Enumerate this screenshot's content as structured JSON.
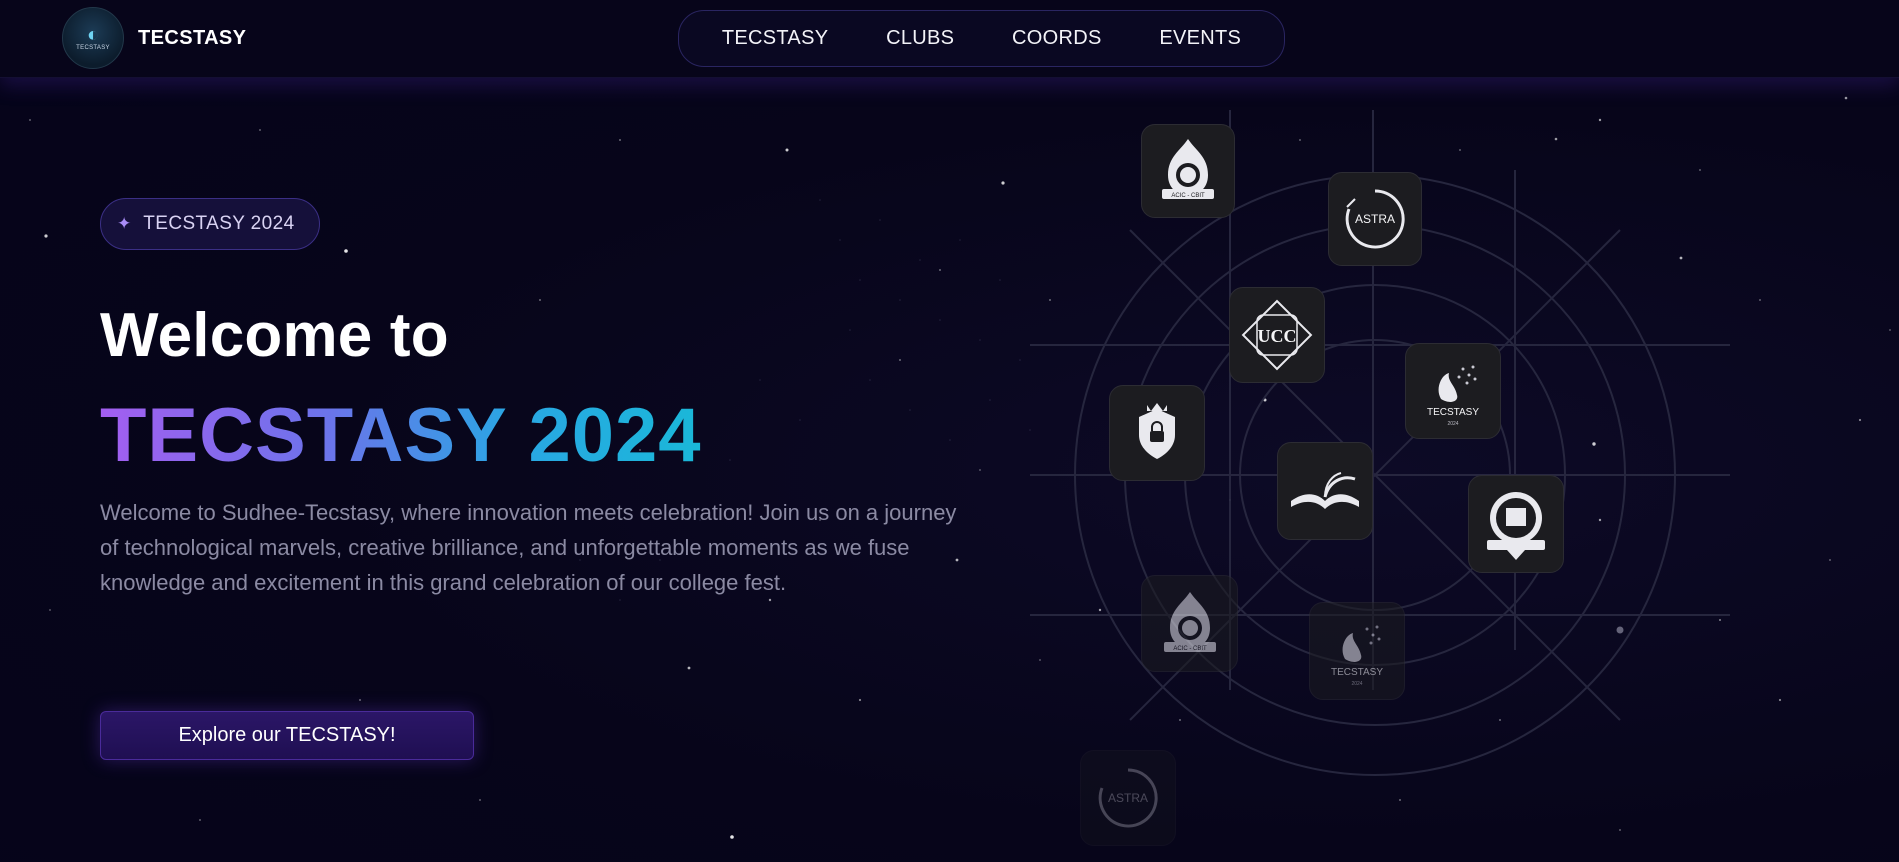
{
  "header": {
    "brand": "TECSTASY",
    "logo_caption": "TECSTASY",
    "nav": [
      "TECSTASY",
      "CLUBS",
      "COORDS",
      "EVENTS"
    ]
  },
  "hero": {
    "badge": "TECSTASY 2024",
    "title_line1": "Welcome to",
    "title_line2": "TECSTASY 2024",
    "description": "Welcome to Sudhee-Tecstasy, where innovation meets celebration! Join us on a journey of technological marvels, creative brilliance, and unforgettable moments as we fuse knowledge and excitement in this grand celebration of our college fest.",
    "cta": "Explore our TECSTASY!"
  },
  "clubs": {
    "acic": "ACIC - CBIT",
    "astra": "ASTRA",
    "ucc": "UCC",
    "tecstasy": "TECSTASY",
    "year": "2024"
  },
  "colors": {
    "background": "#07051a",
    "accent_purple": "#a35ef0",
    "accent_cyan": "#1ab8d8"
  }
}
